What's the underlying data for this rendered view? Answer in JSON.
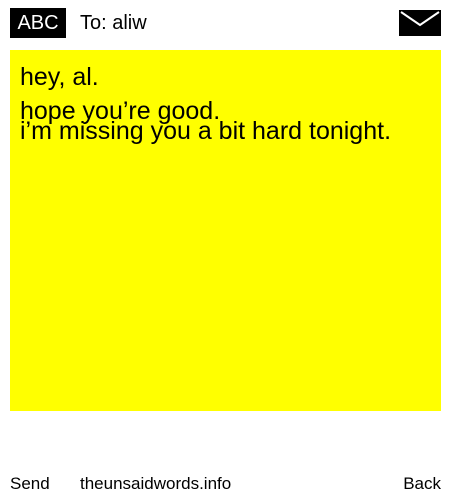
{
  "header": {
    "badge": "ABC",
    "to": "To: aliw",
    "icon": "envelope-icon"
  },
  "note": {
    "background": "#ffff00",
    "lines": [
      "hey, al.",
      "hope you’re good.",
      "i’m missing you a bit hard tonight."
    ]
  },
  "footer": {
    "send": "Send",
    "site": "theunsaidwords.info",
    "back": "Back"
  }
}
